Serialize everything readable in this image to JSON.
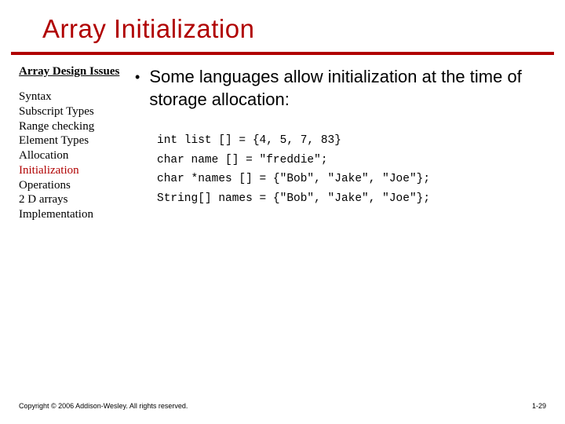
{
  "title": "Array Initialization",
  "sidebar": {
    "heading": "Array Design Issues",
    "items": [
      {
        "label": "Syntax",
        "active": false
      },
      {
        "label": "Subscript Types",
        "active": false
      },
      {
        "label": "Range checking",
        "active": false
      },
      {
        "label": "Element Types",
        "active": false
      },
      {
        "label": "Allocation",
        "active": false
      },
      {
        "label": "Initialization",
        "active": true
      },
      {
        "label": "Operations",
        "active": false
      },
      {
        "label": "2 D arrays",
        "active": false
      },
      {
        "label": "Implementation",
        "active": false
      }
    ]
  },
  "main": {
    "bullet": "Some languages allow initialization at the time of storage allocation:",
    "code": [
      "int list [] = {4, 5, 7, 83}",
      "char name [] = \"freddie\";",
      "char *names [] = {\"Bob\", \"Jake\", \"Joe\"};",
      "String[] names = {\"Bob\", \"Jake\", \"Joe\"};"
    ]
  },
  "footer": {
    "copyright": "Copyright © 2006 Addison-Wesley. All rights reserved.",
    "page": "1-29"
  }
}
